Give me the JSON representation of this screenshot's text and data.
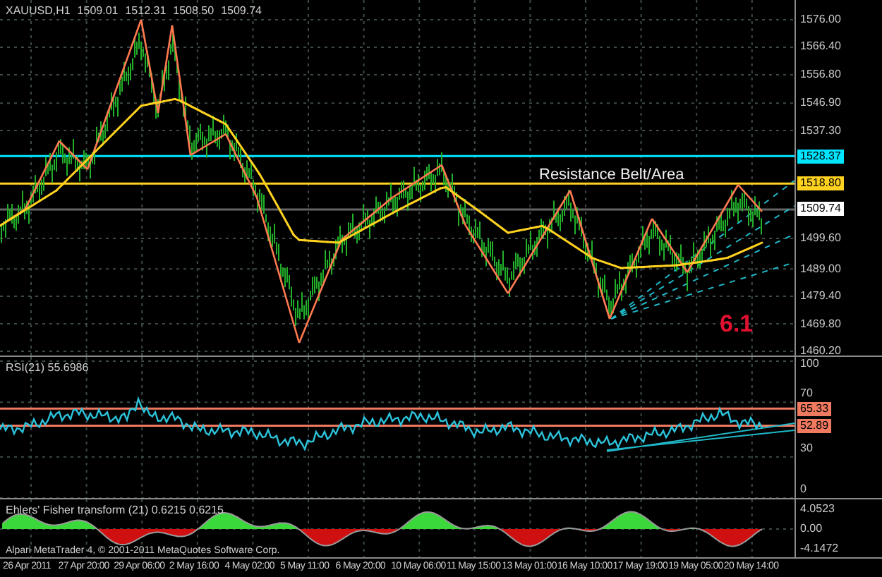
{
  "chart": {
    "symbol": "XAUUSD,H1",
    "ohlc": [
      "1509.01",
      "1512.31",
      "1508.50",
      "1509.74"
    ],
    "price_axis": [
      "1576.00",
      "1566.40",
      "1556.80",
      "1546.90",
      "1537.30",
      "1499.60",
      "1489.00",
      "1479.40",
      "1469.80",
      "1460.20"
    ],
    "price_tags": [
      {
        "price": "1528.37",
        "color": "#00e5ff"
      },
      {
        "price": "1518.80",
        "color": "#ffd21f"
      },
      {
        "price": "1509.74",
        "color": "#ffffff"
      }
    ],
    "annotation": "Resistance Belt/Area",
    "wave_label": "6.1"
  },
  "rsi": {
    "title": "RSI(21) 55.6986",
    "axis": [
      "100",
      "70",
      "30",
      "0"
    ],
    "levels": [
      "65.33",
      "52.89"
    ]
  },
  "fisher": {
    "title": "Ehlers' Fisher transform (21) 0.6215 0.6215",
    "axis": [
      "4.0523",
      "0.00",
      "-4.1472"
    ]
  },
  "copyright": "Alpari MetaTrader 4, © 2001-2011 MetaQuotes Software Corp.",
  "time_axis": [
    "26 Apr 2011",
    "27 Apr 20:00",
    "29 Apr 06:00",
    "2 May 16:00",
    "4 May 02:00",
    "5 May 11:00",
    "6 May 20:00",
    "10 May 06:00",
    "11 May 15:00",
    "13 May 01:00",
    "16 May 10:00",
    "17 May 19:00",
    "19 May 05:00",
    "20 May 14:00"
  ]
}
